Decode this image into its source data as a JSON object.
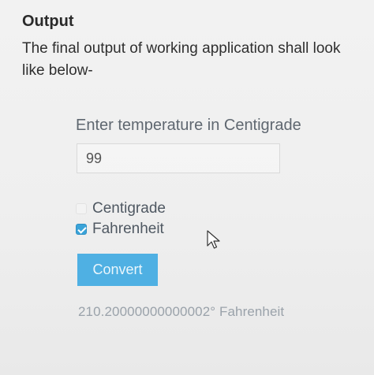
{
  "doc": {
    "heading": "Output",
    "paragraph": "The final output of working application shall look like below-"
  },
  "form": {
    "label": "Enter temperature in Centigrade",
    "input_value": "99",
    "options": [
      {
        "label": "Centigrade",
        "checked": false
      },
      {
        "label": "Fahrenheit",
        "checked": true
      }
    ],
    "convert_label": "Convert",
    "result": "210.20000000000002° Fahrenheit"
  },
  "icons": {
    "cursor": "mouse-pointer-icon",
    "checked_box": "checkbox-checked-icon",
    "unchecked_box": "checkbox-unchecked-icon"
  },
  "colors": {
    "accent": "#4fb0e3",
    "checkbox_checked": "#3aa3d8"
  }
}
